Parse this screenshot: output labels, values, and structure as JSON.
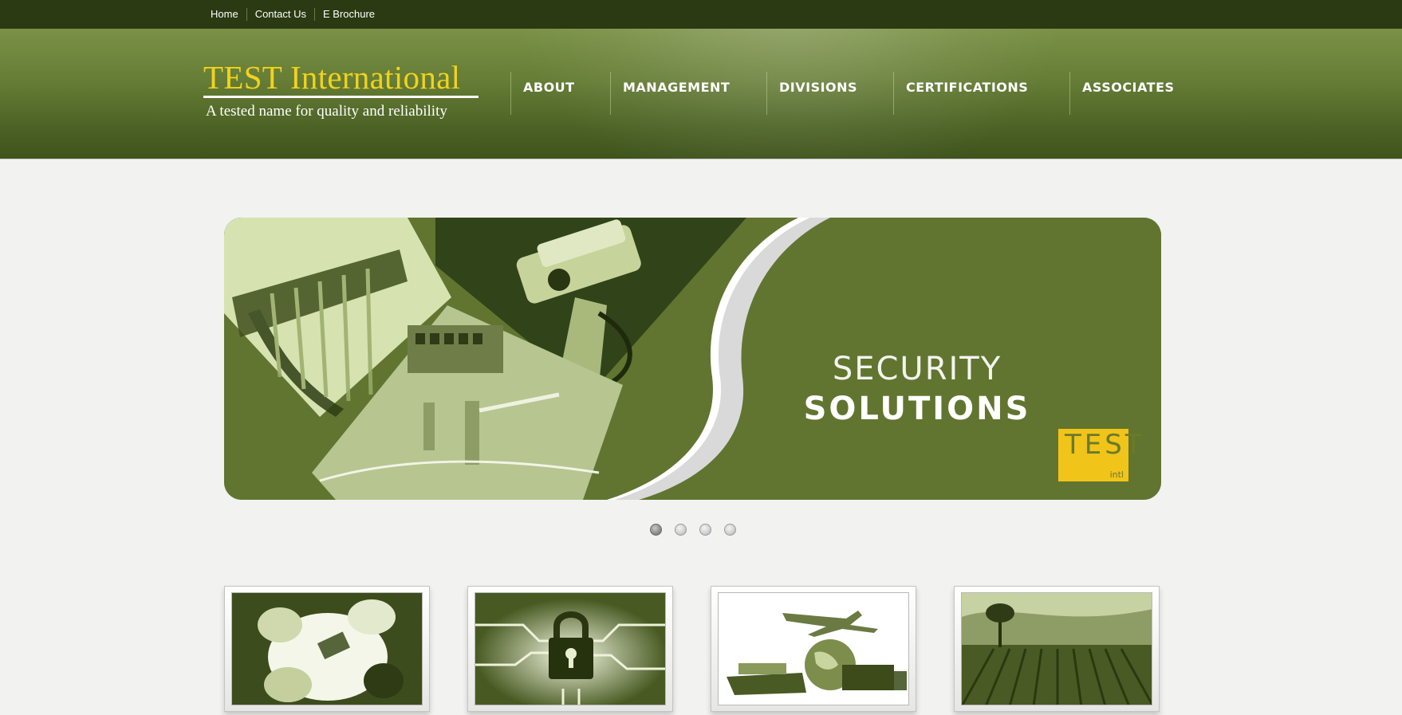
{
  "topbar": {
    "links": [
      "Home",
      "Contact Us",
      "E Brochure"
    ]
  },
  "header": {
    "logo_title": "TEST International",
    "logo_tagline": "A tested name for quality and reliability",
    "nav": [
      "ABOUT",
      "MANAGEMENT",
      "DIVISIONS",
      "CERTIFICATIONS",
      "ASSOCIATES"
    ]
  },
  "slider": {
    "line1": "SECURITY",
    "line2": "SOLUTIONS",
    "badge_text": "TEST",
    "badge_sub": "intl",
    "slide_count": 4,
    "active_slide": 1
  },
  "thumbnails": [
    {
      "icon": "meeting-image"
    },
    {
      "icon": "padlock-circuit-image"
    },
    {
      "icon": "logistics-image"
    },
    {
      "icon": "agriculture-image"
    }
  ],
  "colors": {
    "topbar": "#2b3a12",
    "header": "#667d36",
    "slide_bg": "#617530",
    "logo_yellow": "#f1d21c",
    "badge_yellow": "#f0c419"
  }
}
